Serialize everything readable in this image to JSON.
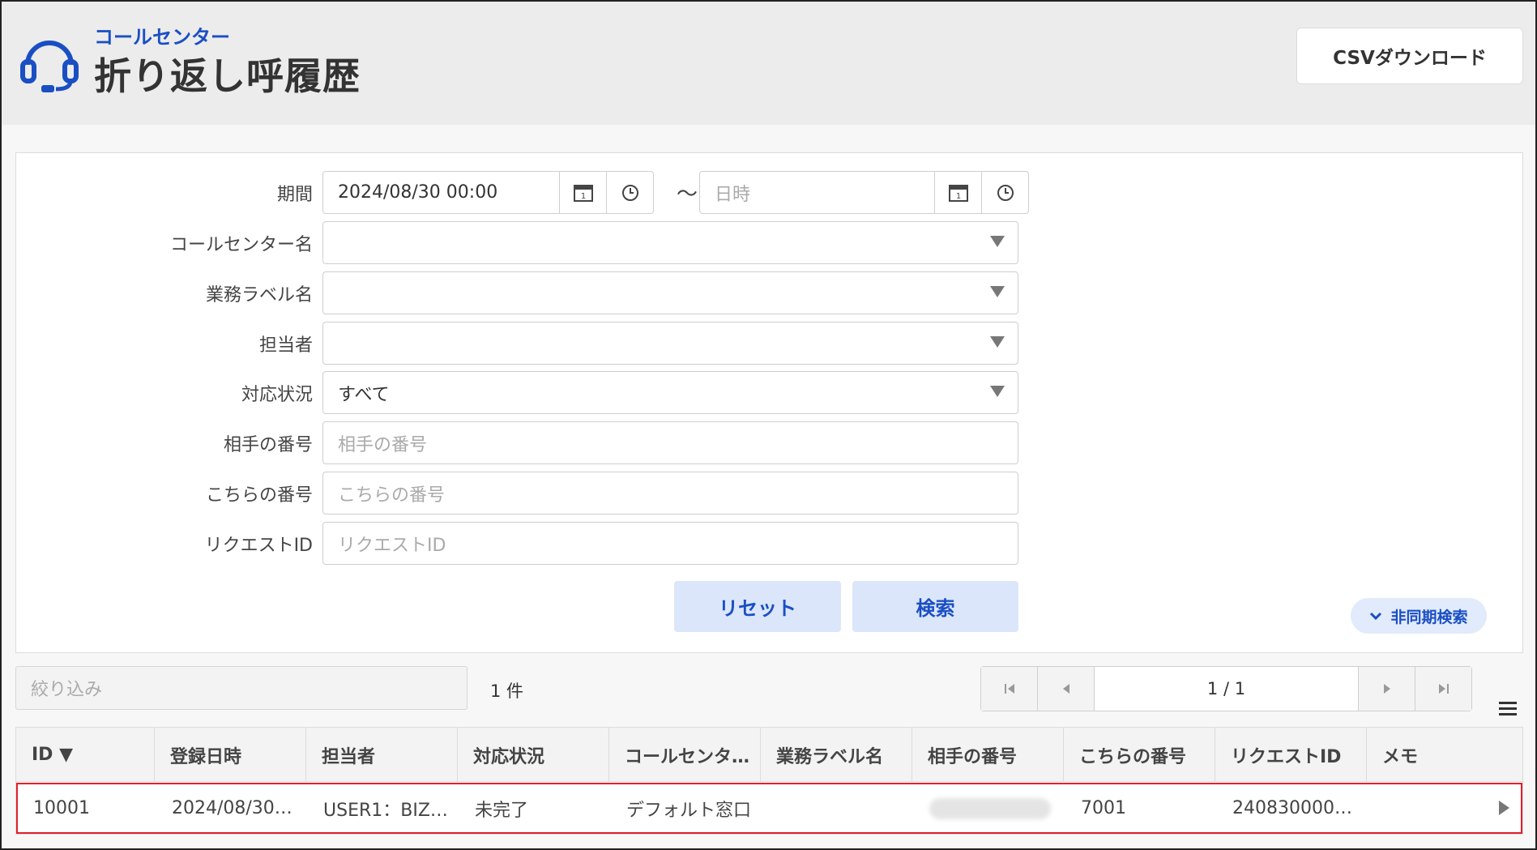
{
  "header": {
    "subtitle": "コールセンター",
    "title": "折り返し呼履歴",
    "csv_button": "CSVダウンロード",
    "accent_color": "#1a4fc4"
  },
  "search": {
    "period_label": "期間",
    "period_from": "2024/08/30 00:00",
    "period_tilde": "～",
    "period_to_placeholder": "日時",
    "callcenter_label": "コールセンター名",
    "callcenter_value": "",
    "business_label_label": "業務ラベル名",
    "business_label_value": "",
    "assignee_label": "担当者",
    "assignee_value": "",
    "status_label": "対応状況",
    "status_value": "すべて",
    "partner_number_label": "相手の番号",
    "partner_number_placeholder": "相手の番号",
    "our_number_label": "こちらの番号",
    "our_number_placeholder": "こちらの番号",
    "request_id_label": "リクエストID",
    "request_id_placeholder": "リクエストID",
    "reset_button": "リセット",
    "search_button": "検索",
    "async_search_button": "非同期検索"
  },
  "list": {
    "filter_placeholder": "絞り込み",
    "count_text": "1 件",
    "pager_text": "1 / 1"
  },
  "table": {
    "columns": [
      "ID ▼",
      "登録日時",
      "担当者",
      "対応状況",
      "コールセンタ…",
      "業務ラベル名",
      "相手の番号",
      "こちらの番号",
      "リクエストID",
      "メモ"
    ],
    "rows": [
      {
        "id": "10001",
        "registered": "2024/08/30…",
        "assignee": "USER1：BIZ…",
        "status": "未完了",
        "callcenter": "デフォルト窓口",
        "business_label": "",
        "partner_number": "",
        "our_number": "7001",
        "request_id": "240830000…",
        "memo": ""
      }
    ],
    "highlight_color": "#e0202a"
  }
}
